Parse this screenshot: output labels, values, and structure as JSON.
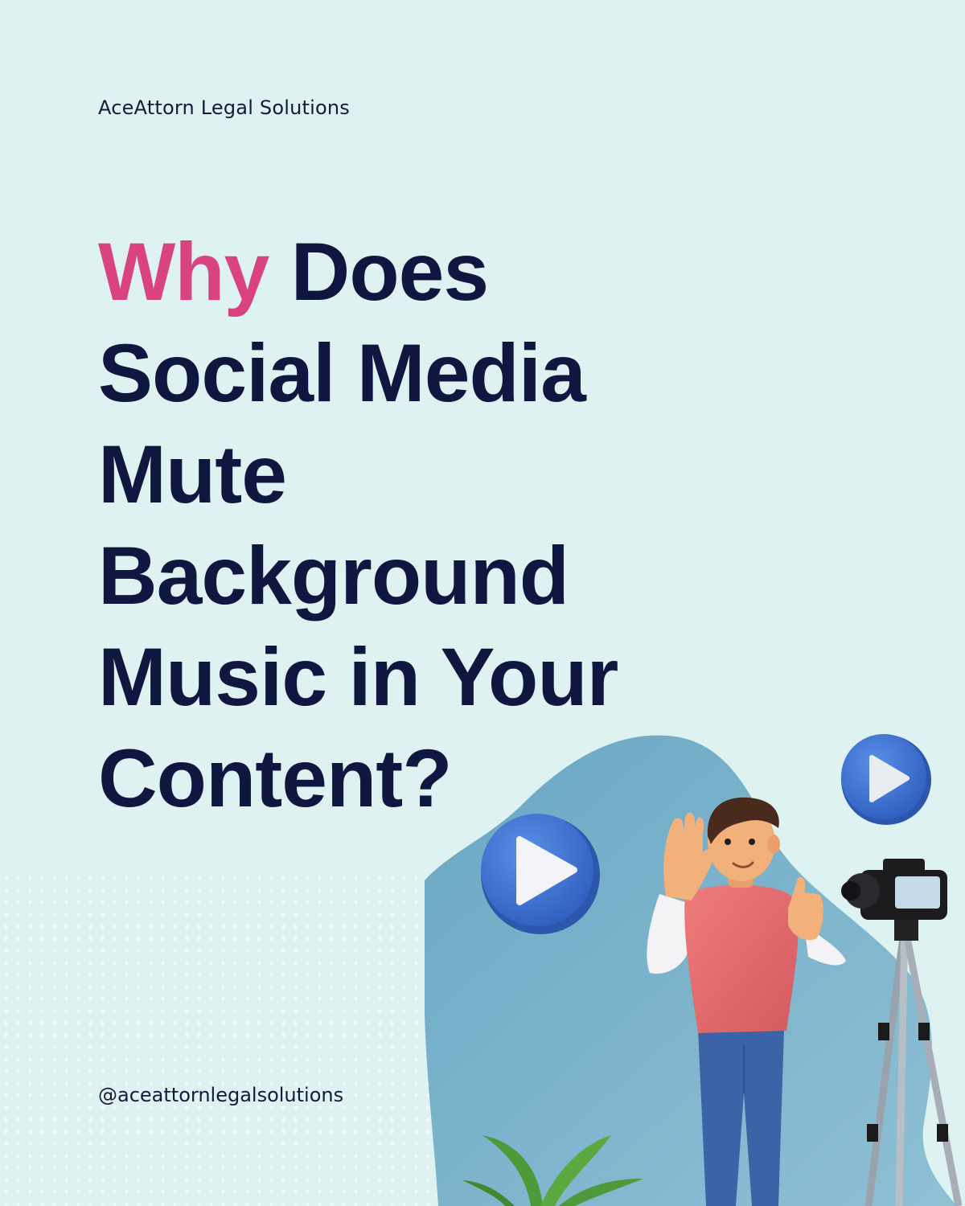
{
  "brand": {
    "name": "AceAttorn Legal Solutions"
  },
  "headline": {
    "accent_word": "Why",
    "line1_rest": "Does",
    "line2": "Social Media",
    "line3": "Mute",
    "line4": "Background",
    "line5": "Music in Your",
    "line6": "Content?"
  },
  "footer": {
    "handle": "@aceattornlegalsolutions"
  },
  "colors": {
    "background": "#dff2f2",
    "accent": "#d9437f",
    "text": "#0f1740",
    "blob": "#7fb5cc",
    "play_button": "#3f74d6",
    "shirt": "#e3666a",
    "jeans": "#3a63a8"
  }
}
